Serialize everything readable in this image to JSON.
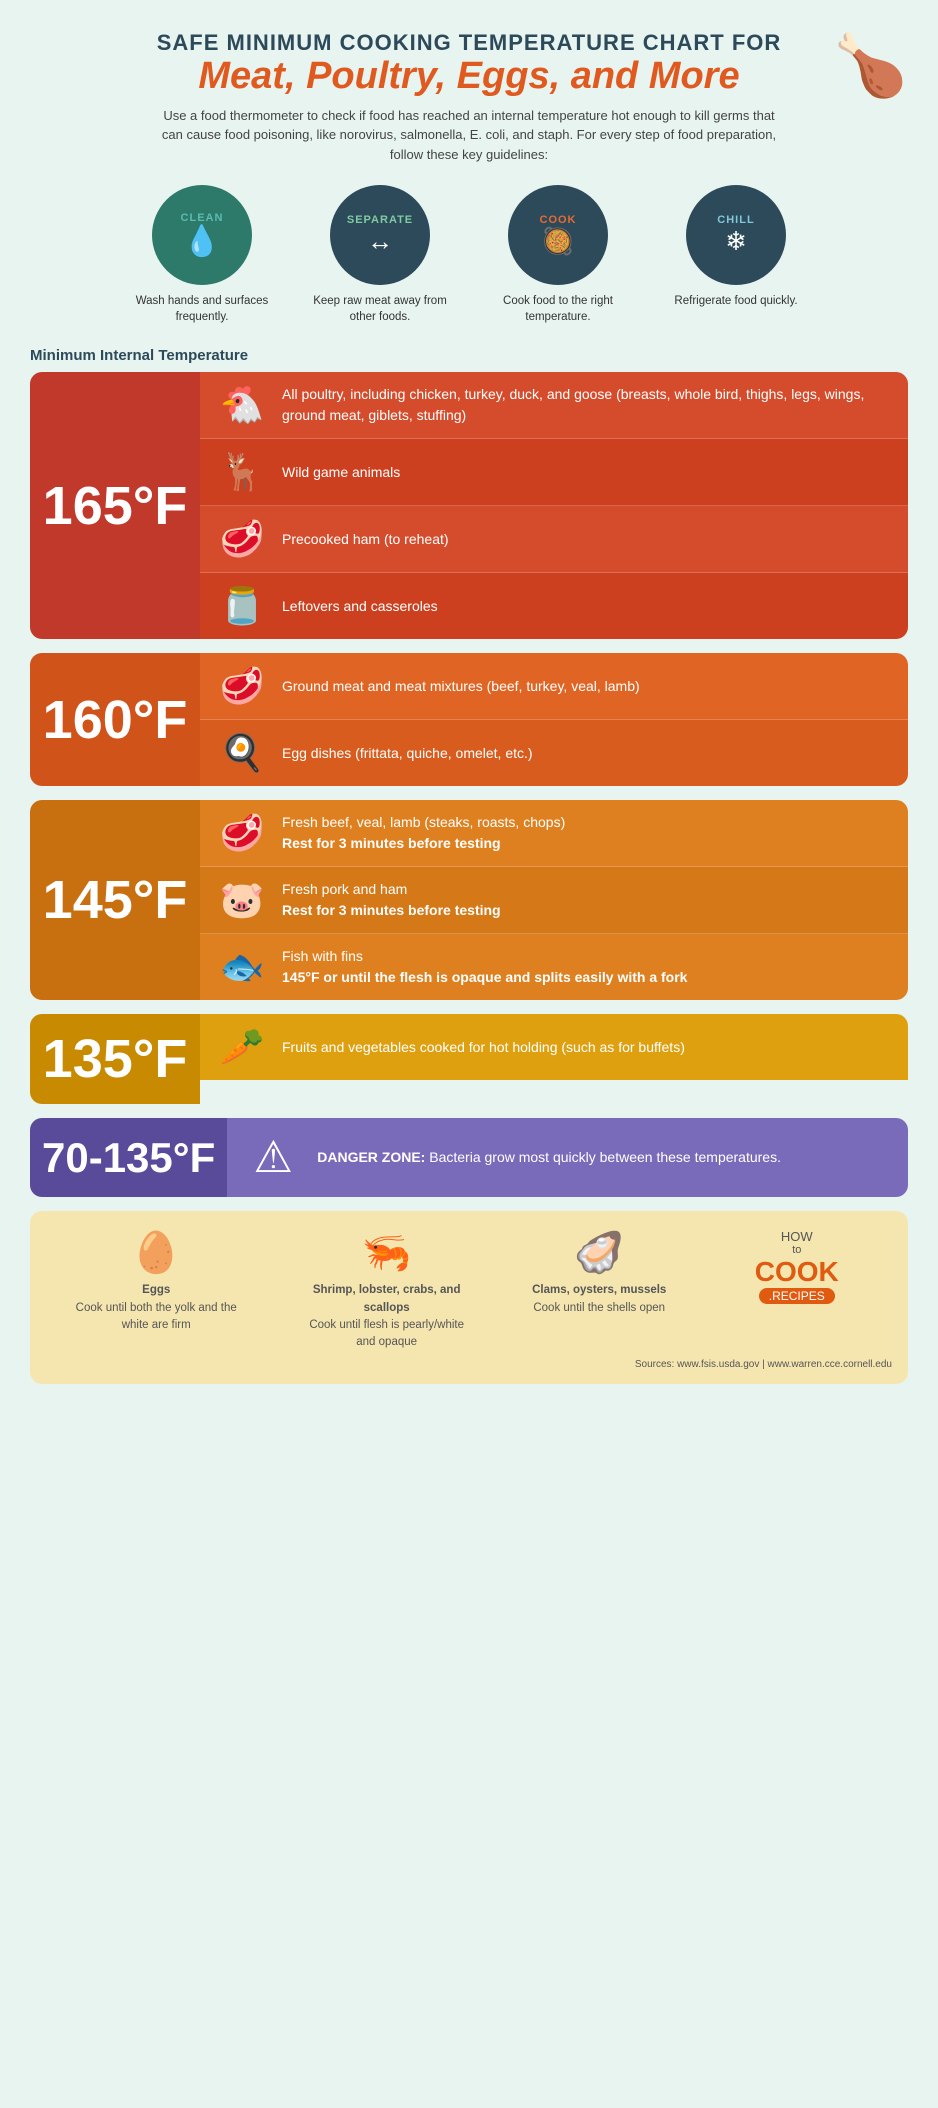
{
  "header": {
    "title_top": "SAFE MINIMUM COOKING TEMPERATURE CHART FOR",
    "title_main": "Meat, Poultry, Eggs, and More",
    "description": "Use a food thermometer to check if food has reached an internal temperature hot enough to kill germs that can cause food poisoning, like norovirus, salmonella, E. coli, and staph. For every step of food preparation, follow these key guidelines:"
  },
  "circles": [
    {
      "label": "CLEAN",
      "label_color": "teal2",
      "desc": "Wash hands and surfaces frequently.",
      "icon": "💧"
    },
    {
      "label": "SEPARATE",
      "label_color": "green",
      "desc": "Keep raw meat away from other foods.",
      "icon": "↔"
    },
    {
      "label": "COOK",
      "label_color": "orange",
      "desc": "Cook food to the right temperature.",
      "icon": "🍳"
    },
    {
      "label": "CHILL",
      "label_color": "lightblue",
      "desc": "Refrigerate food quickly.",
      "icon": "❄"
    }
  ],
  "section_label": "Minimum Internal Temperature",
  "temp_sections": [
    {
      "temp": "165°F",
      "bg_left": "#c0392b",
      "bg_right": "#d44c2c",
      "rows": [
        {
          "text": "All poultry, including chicken, turkey, duck, and goose (breasts, whole bird, thighs, legs, wings, ground meat, giblets, stuffing)",
          "bold": ""
        },
        {
          "text": "Wild game animals",
          "bold": ""
        },
        {
          "text": "Precooked ham (to reheat)",
          "bold": ""
        },
        {
          "text": "Leftovers and casseroles",
          "bold": ""
        }
      ]
    },
    {
      "temp": "160°F",
      "bg_left": "#d0531a",
      "bg_right": "#e06525",
      "rows": [
        {
          "text": "Ground meat and meat mixtures (beef, turkey, veal, lamb)",
          "bold": ""
        },
        {
          "text": "Egg dishes (frittata, quiche, omelet, etc.)",
          "bold": ""
        }
      ]
    },
    {
      "temp": "145°F",
      "bg_left": "#c8700a",
      "bg_right": "#df8020",
      "rows": [
        {
          "text": "Fresh beef, veal, lamb (steaks, roasts, chops)",
          "bold": "Rest for 3 minutes before testing"
        },
        {
          "text": "Fresh pork and ham",
          "bold": "Rest for 3 minutes before testing"
        },
        {
          "text": "Fish with fins",
          "bold": "145°F or until the flesh is opaque and splits easily with a fork"
        }
      ]
    },
    {
      "temp": "135°F",
      "bg_left": "#c88a00",
      "bg_right": "#dfa010",
      "rows": [
        {
          "text": "Fruits and vegetables cooked for hot holding (such as for buffets)",
          "bold": ""
        }
      ]
    },
    {
      "temp": "70-135°F",
      "bg_left": "#5a4a9a",
      "bg_right": "#7a6aba",
      "rows": [
        {
          "text": "Bacteria grow most quickly between these temperatures.",
          "bold": "DANGER ZONE:"
        }
      ]
    }
  ],
  "bottom_items": [
    {
      "icon": "🥚",
      "text_bold": "Eggs",
      "text": "Cook until both the yolk and the white are firm"
    },
    {
      "icon": "🦐",
      "text_bold": "Shrimp, lobster, crabs, and scallops",
      "text": "Cook until flesh is pearly/white and opaque"
    },
    {
      "icon": "🦪",
      "text_bold": "Clams, oysters, mussels",
      "text": "Cook until the shells open"
    }
  ],
  "brand": {
    "how": "HOW",
    "to": "to",
    "cook": "COOK",
    "recipes": ".RECIPES"
  },
  "sources": "Sources: www.fsis.usda.gov | www.warren.cce.cornell.edu"
}
